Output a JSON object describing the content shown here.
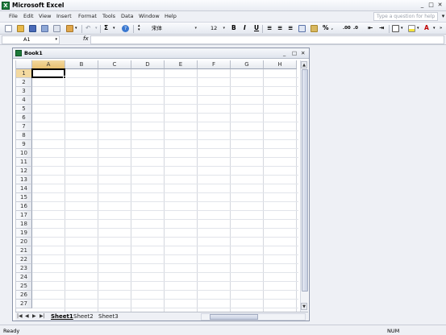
{
  "app": {
    "title": "Microsoft Excel",
    "icon": "excel-icon"
  },
  "window_controls": [
    "_",
    "□",
    "✕"
  ],
  "menu": {
    "items": [
      "File",
      "Edit",
      "View",
      "Insert",
      "Format",
      "Tools",
      "Data",
      "Window",
      "Help"
    ],
    "help_placeholder": "Type a question for help"
  },
  "toolbar": {
    "font_name": "宋体",
    "font_size": "12",
    "bold": "B",
    "italic": "I",
    "underline": "U",
    "sum": "Σ",
    "percent": "%",
    "zoom_help": "?"
  },
  "formula_bar": {
    "name_box": "A1",
    "fx": "fx",
    "value": ""
  },
  "workbook": {
    "title": "Book1",
    "controls": [
      "_",
      "□",
      "✕"
    ]
  },
  "grid": {
    "columns": [
      "A",
      "B",
      "C",
      "D",
      "E",
      "F",
      "G",
      "H"
    ],
    "rows": [
      "1",
      "2",
      "3",
      "4",
      "5",
      "6",
      "7",
      "8",
      "9",
      "10",
      "11",
      "12",
      "13",
      "14",
      "15",
      "16",
      "17",
      "18",
      "19",
      "20",
      "21",
      "22",
      "23",
      "24",
      "25",
      "26",
      "27"
    ],
    "active_cell": "A1"
  },
  "sheets": {
    "tabs": [
      "Sheet1",
      "Sheet2",
      "Sheet3"
    ],
    "active": "Sheet1",
    "nav": [
      "|◀",
      "◀",
      "▶",
      "▶|"
    ]
  },
  "status": {
    "left": "Ready",
    "num": "NUM"
  },
  "colors": {
    "accent": "#1d7a3a",
    "selected_header": "#f3d9a0"
  }
}
